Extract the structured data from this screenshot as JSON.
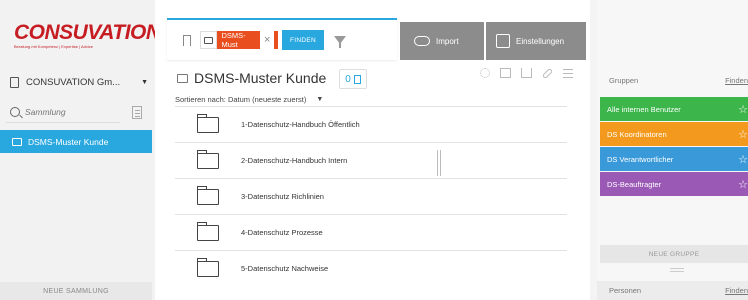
{
  "brand": {
    "logo_text": "CONSUVATION",
    "logo_subtitle": "Beratung mit Kompetenz | Expertise | Advice",
    "color": "#c61d23"
  },
  "left": {
    "org_name": "CONSUVATION Gm...",
    "search_placeholder": "Sammlung",
    "collections": [
      {
        "label": "DSMS-Muster Kunde"
      }
    ],
    "new_collection_label": "NEUE SAMMLUNG"
  },
  "toolbar": {
    "tag_label": "DSMS-Must",
    "find_label": "FINDEN",
    "import_label": "Import",
    "settings_label": "Einstellungen"
  },
  "main": {
    "title": "DSMS-Muster Kunde",
    "count": "0",
    "sort_label": "Sortieren nach:",
    "sort_value": "Datum (neueste zuerst)",
    "folders": [
      {
        "name": "1-Datenschutz-Handbuch Öffentlich"
      },
      {
        "name": "2-Datenschutz-Handbuch Intern"
      },
      {
        "name": "3-Datenschutz Richlinien"
      },
      {
        "name": "4-Datenschutz Prozesse"
      },
      {
        "name": "5-Datenschutz Nachweise"
      }
    ]
  },
  "right": {
    "groups_heading": "Gruppen",
    "groups_find": "Finden",
    "groups": [
      {
        "label": "Alle internen Benutzer",
        "color": "#3cb54a"
      },
      {
        "label": "DS Koordinatoren",
        "color": "#f39a1e"
      },
      {
        "label": "DS Verantwortlicher",
        "color": "#3a9ad9"
      },
      {
        "label": "DS-Beauftragter",
        "color": "#9b59b6"
      }
    ],
    "new_group_label": "NEUE GRUPPE",
    "persons_heading": "Personen",
    "persons_find": "Finden"
  },
  "colors": {
    "accent": "#29a8e0",
    "tag": "#e84e1e",
    "button_gray": "#8c8c8c"
  }
}
